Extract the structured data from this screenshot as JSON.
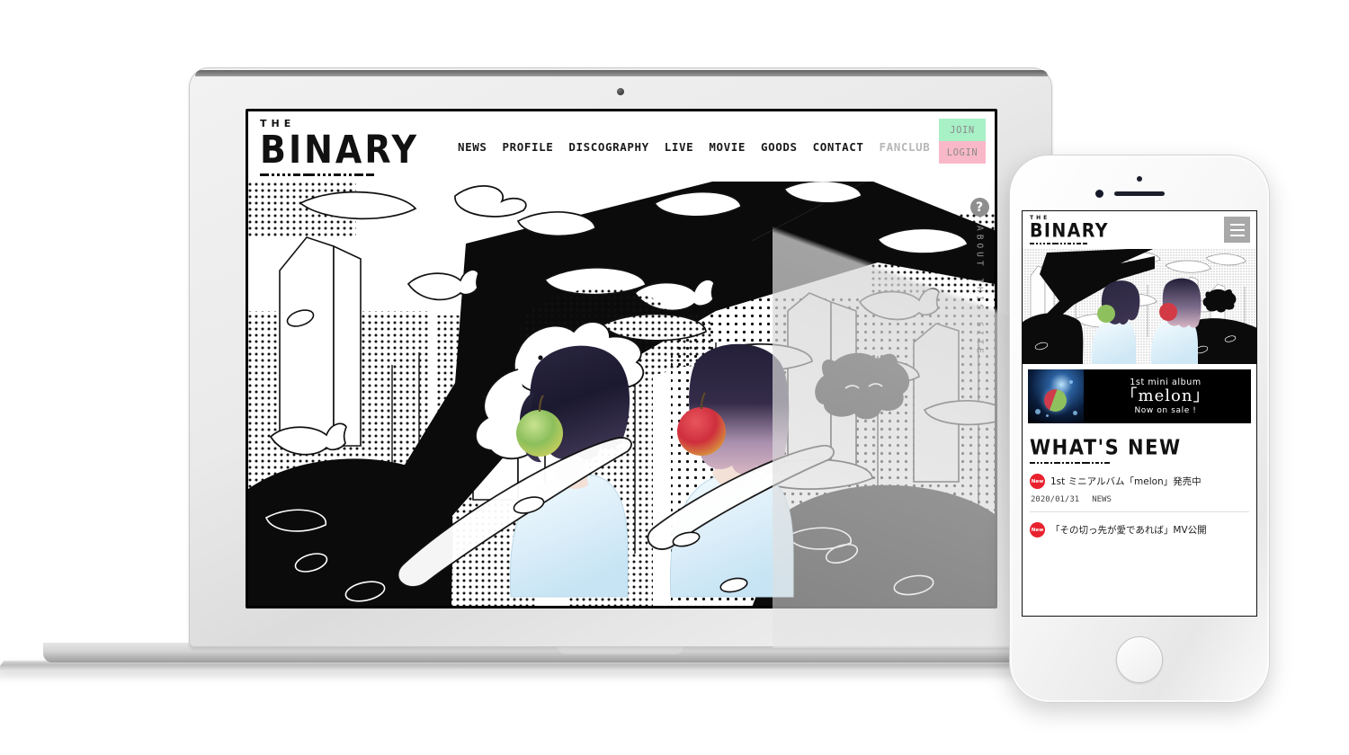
{
  "device_mockup": {
    "laptop_label": "laptop-device",
    "phone_label": "phone-device"
  },
  "site": {
    "logo": {
      "top": "THE",
      "main": "BINARY"
    },
    "nav": [
      {
        "label": "NEWS",
        "dim": false
      },
      {
        "label": "PROFILE",
        "dim": false
      },
      {
        "label": "DISCOGRAPHY",
        "dim": false
      },
      {
        "label": "LIVE",
        "dim": false
      },
      {
        "label": "MOVIE",
        "dim": false
      },
      {
        "label": "GOODS",
        "dim": false
      },
      {
        "label": "CONTACT",
        "dim": false
      },
      {
        "label": "FANCLUB",
        "dim": true
      }
    ],
    "auth": {
      "join": "JOIN",
      "login": "LOGIN"
    },
    "rail": {
      "icon": "question-mark-icon",
      "glyph": "?",
      "text": "ABOUT THIS SITE"
    },
    "colors": {
      "join_bg": "#a8f0c6",
      "login_bg": "#f9b8c8",
      "badge_new": "#e8222e",
      "apple_green": "#8fc05e",
      "apple_red": "#d23a45",
      "shirt_blue": "#d7ecf7"
    }
  },
  "mobile": {
    "menu_icon": "hamburger-menu-icon",
    "banner": {
      "line1": "1st mini album",
      "line2": "「melon」",
      "line3": "Now on sale !"
    },
    "whats_new_title": "WHAT'S NEW",
    "news": [
      {
        "badge": "New",
        "title": "1st ミニアルバム「melon」発売中",
        "date": "2020/01/31",
        "category": "NEWS"
      },
      {
        "badge": "New",
        "title": "「その切っ先が愛であれば」MV公開",
        "date": "",
        "category": ""
      }
    ]
  }
}
